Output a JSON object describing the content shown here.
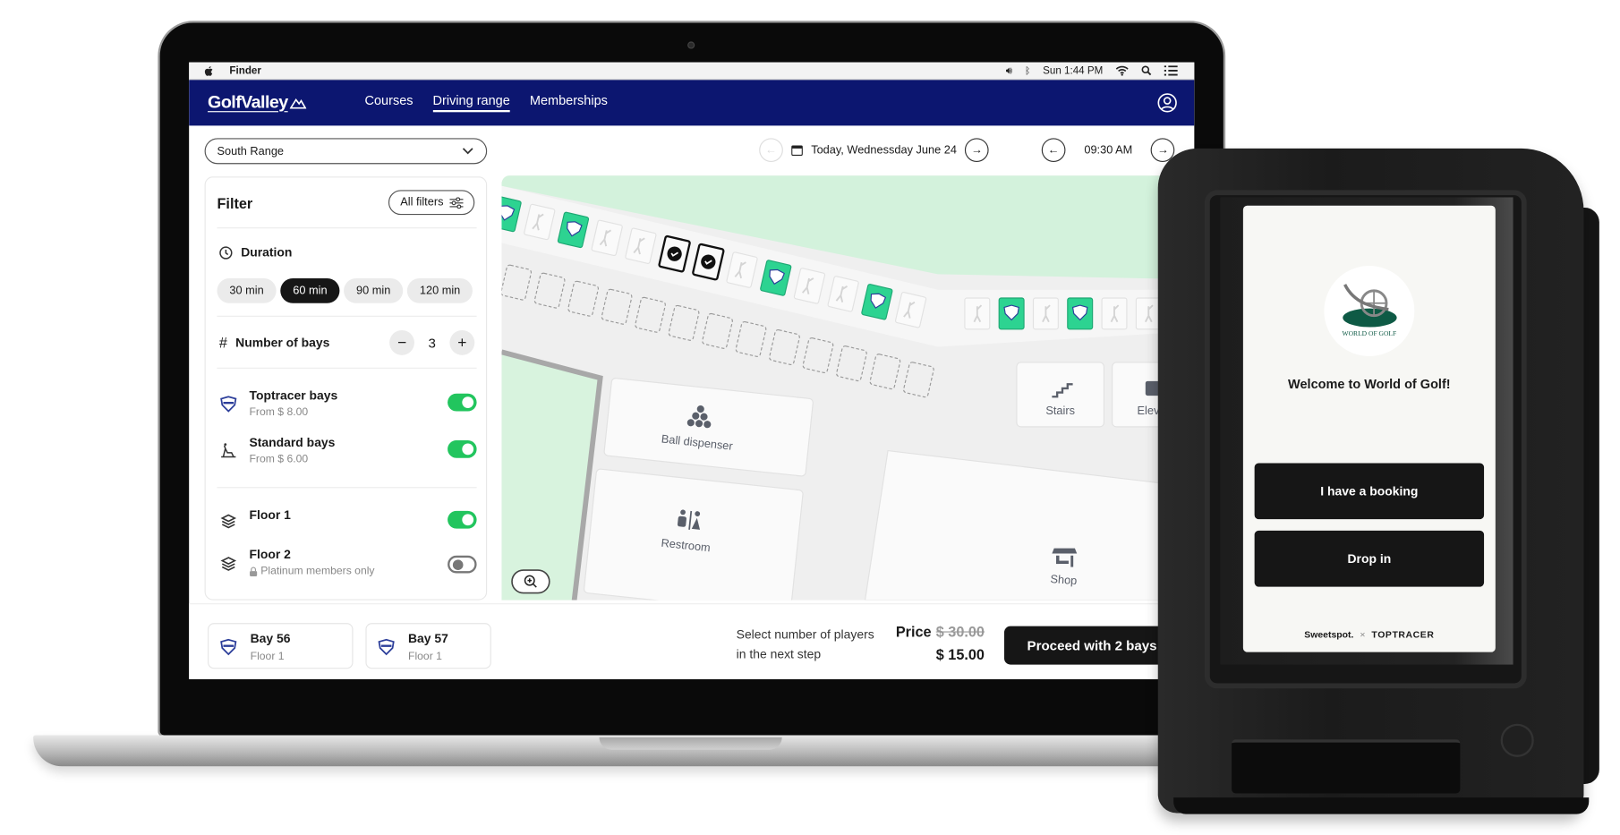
{
  "menubar": {
    "app_name": "Finder",
    "clock": "Sun 1:44 PM",
    "icons": [
      "apple-icon",
      "volume-icon",
      "bluetooth-icon",
      "wifi-icon",
      "search-icon",
      "list-icon"
    ]
  },
  "nav": {
    "logo": "GolfValley",
    "links": [
      {
        "label": "Courses",
        "active": false
      },
      {
        "label": "Driving range",
        "active": true
      },
      {
        "label": "Memberships",
        "active": false
      }
    ],
    "brand_color": "#0c1670"
  },
  "range_select": {
    "value": "South Range"
  },
  "datebar": {
    "date": "Today, Wednessday June 24",
    "time": "09:30 AM"
  },
  "filter": {
    "title": "Filter",
    "all_filters_label": "All filters",
    "duration": {
      "label": "Duration",
      "options": [
        "30 min",
        "60 min",
        "90 min",
        "120 min"
      ],
      "selected": "60 min"
    },
    "bays_count": {
      "label": "Number of bays",
      "value": "3",
      "minus": "−",
      "plus": "+"
    },
    "bay_types": [
      {
        "name": "Toptracer bays",
        "sub": "From $ 8.00",
        "enabled": true
      },
      {
        "name": "Standard bays",
        "sub": "From $ 6.00",
        "enabled": true
      }
    ],
    "floors": [
      {
        "name": "Floor 1",
        "sub": "",
        "enabled": true
      },
      {
        "name": "Floor 2",
        "sub": "Platinum members only",
        "enabled": false
      }
    ],
    "toggle_on_color": "#22c55e"
  },
  "map": {
    "facilities": [
      {
        "label": "Ball dispenser"
      },
      {
        "label": "Restroom"
      },
      {
        "label": "Stairs"
      },
      {
        "label": "Elevator"
      },
      {
        "label": "Shop"
      }
    ],
    "bay_available_color": "#2dd391",
    "grass_color": "#d3f2dc"
  },
  "selection": {
    "bays": [
      {
        "name": "Bay 56",
        "floor": "Floor 1"
      },
      {
        "name": "Bay 57",
        "floor": "Floor 1"
      }
    ],
    "hint": "Select number of players in the next step",
    "price_label": "Price",
    "old_price": "$ 30.00",
    "new_price": "$ 15.00",
    "proceed_label": "Proceed with 2 bays"
  },
  "kiosk": {
    "logo_text": "WORLD OF GOLF",
    "welcome": "Welcome to World of Golf!",
    "booking_button": "I have a booking",
    "dropin_button": "Drop in",
    "footer_left": "Sweetspot.",
    "footer_sep": "×",
    "footer_right": "TOPTRACER"
  }
}
